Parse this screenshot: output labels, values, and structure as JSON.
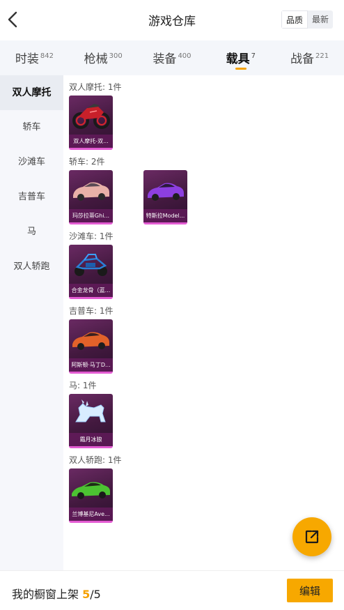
{
  "header": {
    "title": "游戏仓库",
    "sort_options": [
      "品质",
      "最新"
    ],
    "sort_selected": "品质"
  },
  "categories": [
    {
      "label": "时装",
      "count": "842"
    },
    {
      "label": "枪械",
      "count": "300"
    },
    {
      "label": "装备",
      "count": "400"
    },
    {
      "label": "载具",
      "count": "7",
      "active": true
    },
    {
      "label": "战备",
      "count": "221"
    }
  ],
  "sidebar": {
    "items": [
      {
        "label": "双人摩托",
        "active": true
      },
      {
        "label": "轿车"
      },
      {
        "label": "沙滩车"
      },
      {
        "label": "吉普车"
      },
      {
        "label": "马"
      },
      {
        "label": "双人轿跑"
      }
    ]
  },
  "groups": [
    {
      "title": "双人摩托: 1件",
      "items": [
        {
          "name": "双人摩托-双...",
          "icon": "motorcycle-icon"
        }
      ]
    },
    {
      "title": "轿车: 2件",
      "items": [
        {
          "name": "玛莎拉蒂Ghi...",
          "icon": "pink-sedan-icon"
        },
        {
          "name": "特斯拉Model...",
          "icon": "purple-sedan-icon"
        }
      ]
    },
    {
      "title": "沙滩车: 1件",
      "items": [
        {
          "name": "合金龙骨（蓝...",
          "icon": "buggy-icon"
        }
      ]
    },
    {
      "title": "吉普车: 1件",
      "items": [
        {
          "name": "阿斯顿·马丁D...",
          "icon": "orange-car-icon"
        }
      ]
    },
    {
      "title": "马: 1件",
      "items": [
        {
          "name": "霜月冰狼",
          "icon": "ice-wolf-icon"
        }
      ]
    },
    {
      "title": "双人轿跑: 1件",
      "items": [
        {
          "name": "兰博基尼Ave...",
          "icon": "green-supercar-icon"
        }
      ]
    }
  ],
  "footer": {
    "showcase_label": "我的橱窗上架",
    "showcase_current": "5",
    "showcase_total": "/5",
    "edit_label": "编辑"
  },
  "colors": {
    "accent": "#f7a800",
    "card_border": "#e35bd2",
    "card_bg": "#4a1b45"
  }
}
